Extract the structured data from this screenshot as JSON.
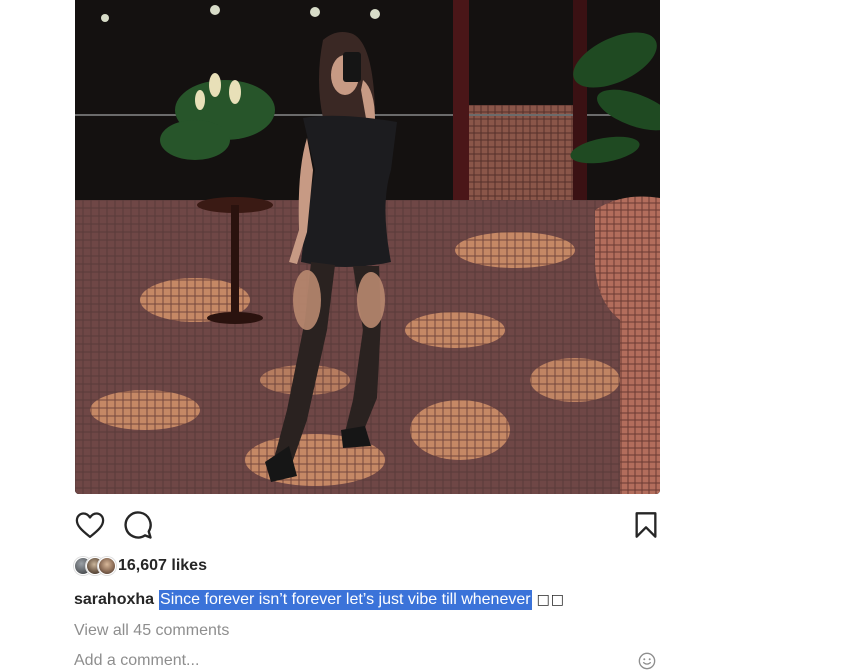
{
  "post": {
    "likes_label": "16,607 likes",
    "username": "sarahoxha",
    "caption": "Since forever isn’t forever let’s just vibe till whenever",
    "caption_emoji": "□□",
    "view_comments_label": "View all 45 comments",
    "add_comment_placeholder": "Add a comment..."
  },
  "icons": {
    "like": "heart-icon",
    "comment": "comment-bubble-icon",
    "save": "bookmark-icon",
    "emoji": "smiley-icon"
  },
  "colors": {
    "selection_highlight": "#3b73d9",
    "muted_text": "#8e8e8e",
    "primary_text": "#262626"
  }
}
